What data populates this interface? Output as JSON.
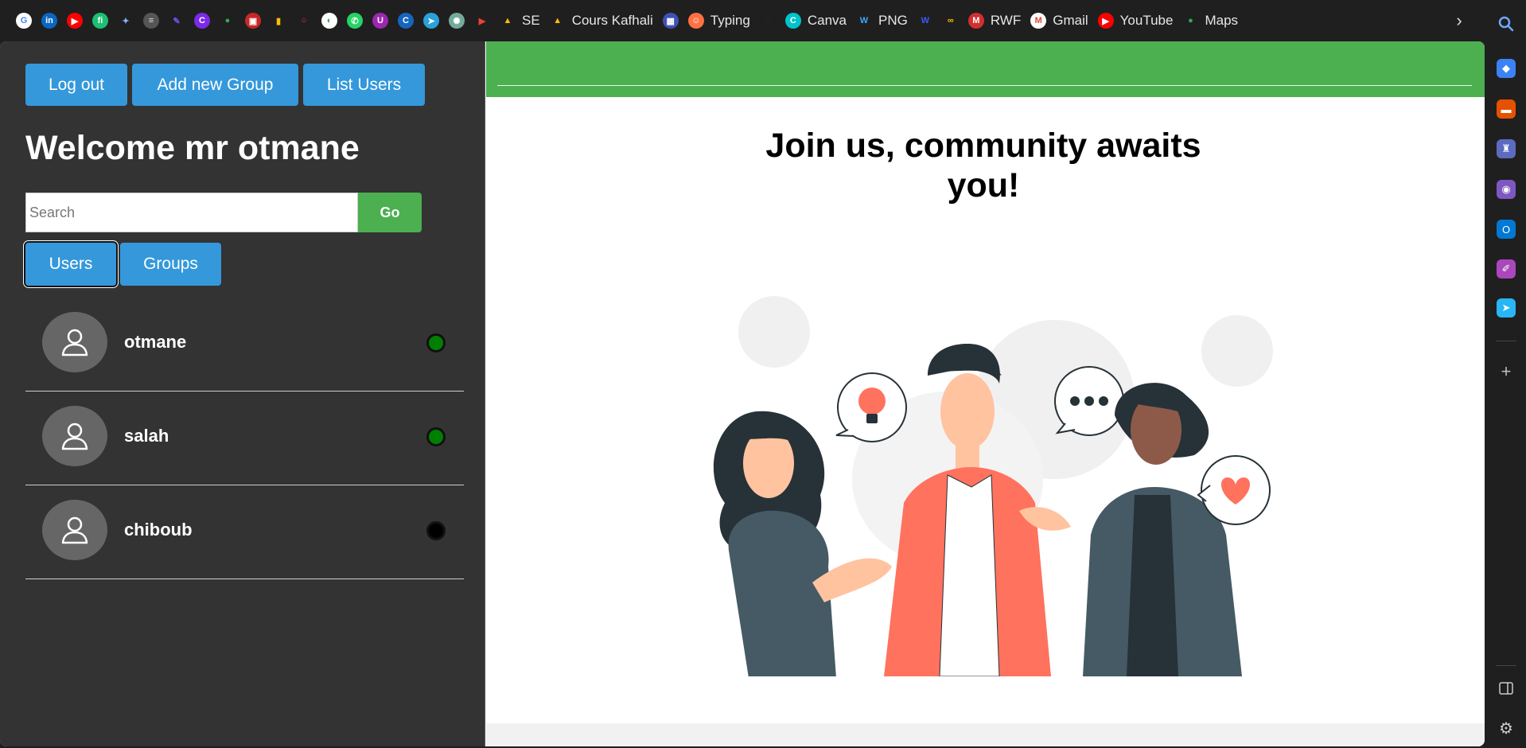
{
  "bookmarks": [
    {
      "name": "google",
      "label": "",
      "icon": "G",
      "color": "#ffffff",
      "fg": "#4285f4"
    },
    {
      "name": "linkedin",
      "label": "",
      "icon": "in",
      "color": "#0a66c2",
      "fg": "#ffffff"
    },
    {
      "name": "youtube-1",
      "label": "",
      "icon": "▶",
      "color": "#ff0000",
      "fg": "#ffffff"
    },
    {
      "name": "fiverr",
      "label": "",
      "icon": "fi",
      "color": "#1dbf73",
      "fg": "#ffffff"
    },
    {
      "name": "app-5",
      "label": "",
      "icon": "✦",
      "color": "#1f1f1f",
      "fg": "#8ab4f8"
    },
    {
      "name": "layers",
      "label": "",
      "icon": "≡",
      "color": "#555555",
      "fg": "#dddddd"
    },
    {
      "name": "app-7",
      "label": "",
      "icon": "✎",
      "color": "#1f1f1f",
      "fg": "#7c4dff"
    },
    {
      "name": "canva-1",
      "label": "",
      "icon": "C",
      "color": "#7d2ae8",
      "fg": "#ffffff"
    },
    {
      "name": "maps-1",
      "label": "",
      "icon": "●",
      "color": "#1f1f1f",
      "fg": "#34a853"
    },
    {
      "name": "app-10",
      "label": "",
      "icon": "▣",
      "color": "#c62828",
      "fg": "#ffffff"
    },
    {
      "name": "app-11",
      "label": "",
      "icon": "▮",
      "color": "#1f1f1f",
      "fg": "#fbbc04"
    },
    {
      "name": "app-12",
      "label": "",
      "icon": "○",
      "color": "#1f1f1f",
      "fg": "#ea4335"
    },
    {
      "name": "app-13",
      "label": "",
      "icon": "◐",
      "color": "#ffffff",
      "fg": "#34a853"
    },
    {
      "name": "whatsapp",
      "label": "",
      "icon": "✆",
      "color": "#25d366",
      "fg": "#ffffff"
    },
    {
      "name": "app-15",
      "label": "",
      "icon": "U",
      "color": "#9c27b0",
      "fg": "#ffffff"
    },
    {
      "name": "app-16",
      "label": "",
      "icon": "C",
      "color": "#1565c0",
      "fg": "#ffffff"
    },
    {
      "name": "telegram",
      "label": "",
      "icon": "➤",
      "color": "#2aa1da",
      "fg": "#ffffff"
    },
    {
      "name": "chatgpt",
      "label": "",
      "icon": "✺",
      "color": "#74aa9c",
      "fg": "#ffffff"
    },
    {
      "name": "app-19",
      "label": "",
      "icon": "▶",
      "color": "#1f1f1f",
      "fg": "#ea4335"
    },
    {
      "name": "drive-se",
      "label": "SE",
      "icon": "▲",
      "color": "#1f1f1f",
      "fg": "#fbbc04"
    },
    {
      "name": "drive-cours",
      "label": "Cours Kafhali",
      "icon": "▲",
      "color": "#1f1f1f",
      "fg": "#fbbc04"
    },
    {
      "name": "app-22",
      "label": "",
      "icon": "▦",
      "color": "#3f51b5",
      "fg": "#ffffff"
    },
    {
      "name": "typing",
      "label": "Typing",
      "icon": "☺",
      "color": "#ff7043",
      "fg": "#ffffff"
    },
    {
      "name": "app-24",
      "label": "",
      "icon": "P",
      "color": "#1f1f1f",
      "fg": "#222222"
    },
    {
      "name": "canva-2",
      "label": "Canva",
      "icon": "C",
      "color": "#00c4cc",
      "fg": "#ffffff"
    },
    {
      "name": "png",
      "label": "PNG",
      "icon": "W",
      "color": "#1f1f1f",
      "fg": "#42a5f5"
    },
    {
      "name": "app-27",
      "label": "",
      "icon": "W",
      "color": "#1f1f1f",
      "fg": "#3d5afe"
    },
    {
      "name": "app-28",
      "label": "",
      "icon": "∞",
      "color": "#1f1f1f",
      "fg": "#fbbc04"
    },
    {
      "name": "rwf",
      "label": "RWF",
      "icon": "M",
      "color": "#d32f2f",
      "fg": "#ffffff"
    },
    {
      "name": "gmail",
      "label": "Gmail",
      "icon": "M",
      "color": "#ffffff",
      "fg": "#ea4335"
    },
    {
      "name": "youtube-2",
      "label": "YouTube",
      "icon": "▶",
      "color": "#ff0000",
      "fg": "#ffffff"
    },
    {
      "name": "maps-2",
      "label": "Maps",
      "icon": "●",
      "color": "#1f1f1f",
      "fg": "#34a853"
    }
  ],
  "toolbar": {
    "logout_label": "Log out",
    "add_group_label": "Add new Group",
    "list_users_label": "List Users"
  },
  "welcome": "Welcome mr otmane",
  "search": {
    "placeholder": "Search",
    "go_label": "Go"
  },
  "tabs": {
    "users_label": "Users",
    "groups_label": "Groups"
  },
  "users": [
    {
      "name": "otmane",
      "status": "online",
      "status_color": "#008000"
    },
    {
      "name": "salah",
      "status": "online",
      "status_color": "#008000"
    },
    {
      "name": "chiboub",
      "status": "offline",
      "status_color": "#000000"
    }
  ],
  "hero": {
    "title": "Join us, community awaits you!"
  },
  "colors": {
    "header_green": "#4caf50",
    "button_blue": "#3498db",
    "panel_dark": "#333333",
    "accent_coral": "#ff725e"
  }
}
